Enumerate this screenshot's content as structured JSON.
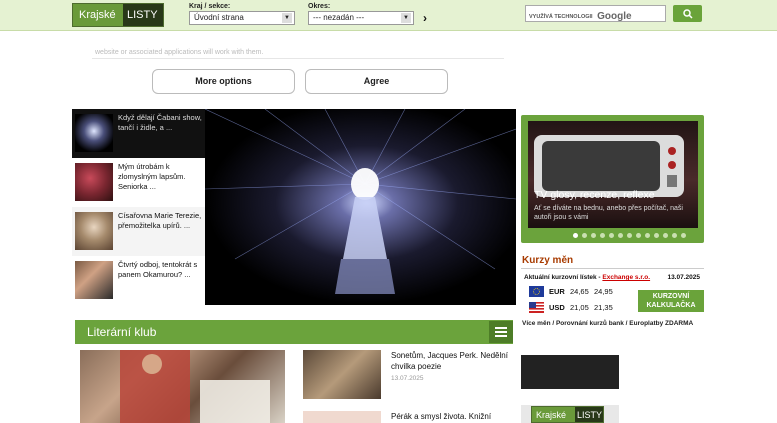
{
  "header": {
    "logo": {
      "part1": "Krajské",
      "part2": "LISTY"
    },
    "kraj": {
      "label": "Kraj / sekce:",
      "value": "Úvodní strana"
    },
    "okres": {
      "label": "Okres:",
      "value": "--- nezadán ---"
    },
    "go_glyph": "›",
    "search": {
      "powered_by": "VYUŽÍVÁ TECHNOLOGII",
      "brand": "Google",
      "button_glyph": "🔍"
    }
  },
  "consent": {
    "text": "website or associated applications will work with them.",
    "more_options": "More options",
    "agree": "Agree"
  },
  "slider": {
    "items": [
      {
        "text": "Když dělají Čabani show, tančí i židle, a ..."
      },
      {
        "text": "Mým útrobám k zlomyslným lapsům. Seniorka ..."
      },
      {
        "text": "Císařovna Marie Terezie, přemožitelka upírů. ..."
      },
      {
        "text": "Čtvrtý odboj, tentokrát s panem Okamurou? ..."
      }
    ]
  },
  "tv": {
    "title": "TV glosy, recenze, reflexe",
    "text": "Ať se díváte na bednu, anebo přes počítač, naši autoři jsou s vámi",
    "dots": 13,
    "active_dot": 0
  },
  "kurzy": {
    "title": "Kurzy měn",
    "subtitle_prefix": "Aktuální kurzovní lístek -",
    "source": "Exchange s.r.o.",
    "date": "13.07.2025",
    "rates": [
      {
        "currency": "EUR",
        "buy": "24,65",
        "sell": "24,95"
      },
      {
        "currency": "USD",
        "buy": "21,05",
        "sell": "21,35"
      }
    ],
    "calc_line1": "KURZOVNÍ",
    "calc_line2": "KALKULAČKA",
    "links": "Více měn / Porovnání kurzů bank / Europlatby ZDARMA"
  },
  "literarni_klub": {
    "title": "Literární klub",
    "articles": [
      {
        "title": "Sonetům, Jacques Perk. Nedělní chvilka poezie",
        "date": "13.07.2025"
      },
      {
        "title": "Pérák a smysl života. Knižní",
        "date": ""
      }
    ]
  },
  "footer_logo": {
    "part1": "Krajské",
    "part2": "LISTY"
  }
}
